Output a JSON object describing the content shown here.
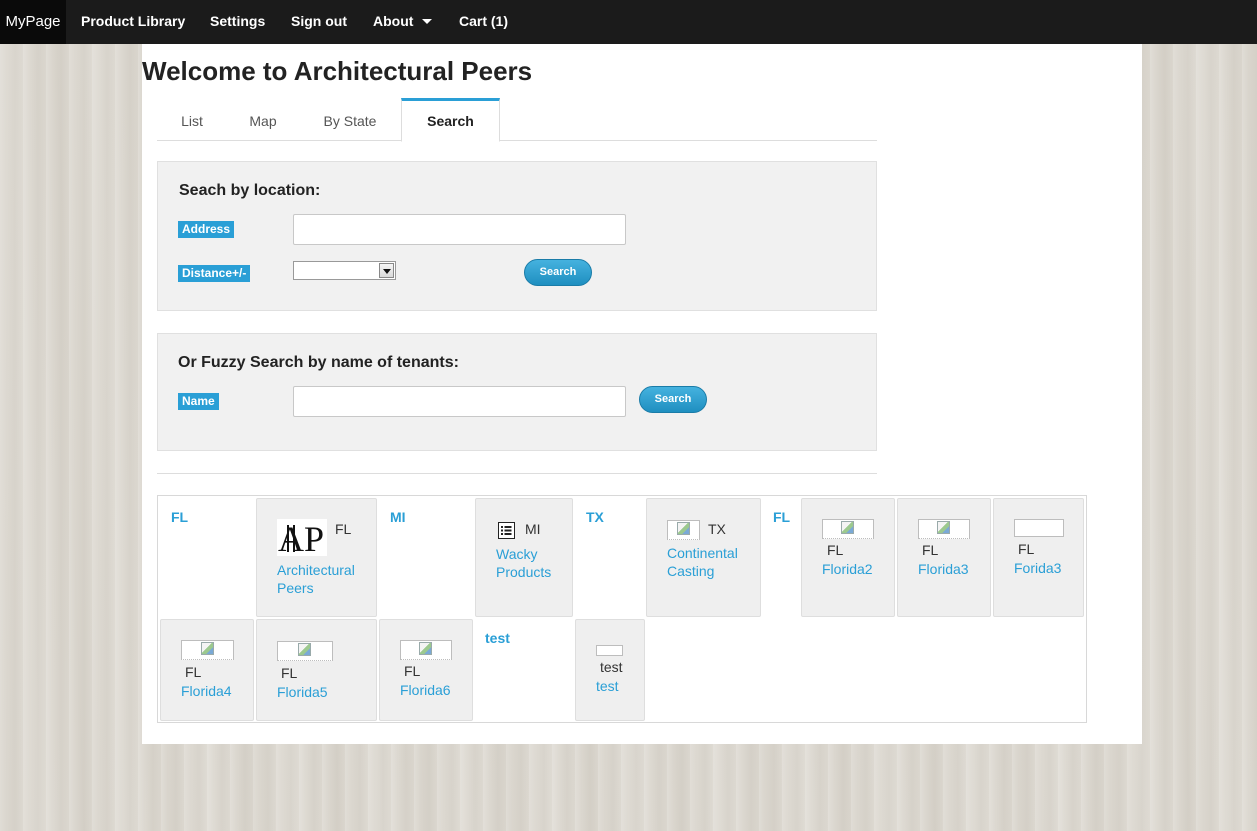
{
  "nav": {
    "brand": "MyPage",
    "items": [
      "Product Library",
      "Settings",
      "Sign out",
      "About",
      "Cart (1)"
    ]
  },
  "page": {
    "title": "Welcome to Architectural Peers"
  },
  "tabs": [
    "List",
    "Map",
    "By State",
    "Search"
  ],
  "active_tab": "Search",
  "location_search": {
    "heading": "Seach by location:",
    "address_label": "Address",
    "address_value": "",
    "distance_label": "Distance+/-",
    "distance_value": "",
    "button": "Search"
  },
  "fuzzy_search": {
    "heading": "Or Fuzzy Search by name of tenants:",
    "name_label": "Name",
    "name_value": "",
    "button": "Search"
  },
  "results": {
    "headers": [
      "FL",
      "MI",
      "TX",
      "FL",
      "test"
    ],
    "cards": [
      {
        "state": "FL",
        "name_line1": "Architectural",
        "name_line2": "Peers",
        "logo_text": "AP"
      },
      {
        "state": "MI",
        "name_line1": "Wacky",
        "name_line2": "Products",
        "icon": "list-icon"
      },
      {
        "state": "TX",
        "name_line1": "Continental",
        "name_line2": "Casting"
      },
      {
        "state": "FL",
        "name": "Florida2"
      },
      {
        "state": "FL",
        "name": "Florida3"
      },
      {
        "state": "FL",
        "name": "Forida3"
      },
      {
        "state": "FL",
        "name": "Florida4"
      },
      {
        "state": "FL",
        "name": "Florida5"
      },
      {
        "state": "FL",
        "name": "Florida6"
      },
      {
        "state": "test",
        "name": "test"
      }
    ]
  },
  "colors": {
    "accent": "#2a9fd6",
    "navbar": "#1b1b1b",
    "well": "#f1f1f1"
  }
}
